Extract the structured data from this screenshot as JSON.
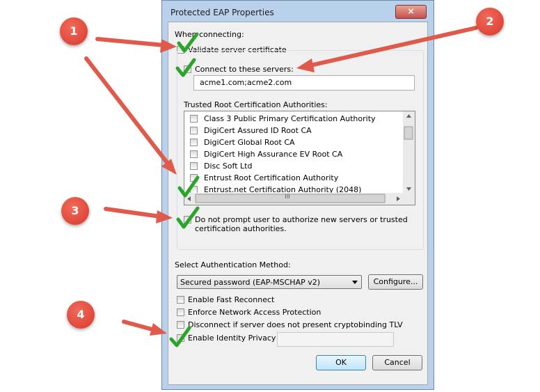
{
  "window": {
    "title": "Protected EAP Properties",
    "close_glyph": "×"
  },
  "connecting": {
    "header": "When connecting:",
    "validate_label": "Validate server certificate",
    "connect_label": "Connect to these servers:",
    "servers_value": "acme1.com;acme2.com"
  },
  "trusted": {
    "header": "Trusted Root Certification Authorities:",
    "items": [
      "Class 3 Public Primary Certification Authority",
      "DigiCert Assured ID Root CA",
      "DigiCert Global Root CA",
      "DigiCert High Assurance EV Root CA",
      "Disc Soft Ltd",
      "Entrust Root Certification Authority",
      "Entrust.net Certification Authority (2048)"
    ],
    "scroll_thumb_glyph": "III"
  },
  "prompt": {
    "line1": "Do not prompt user to authorize new servers or trusted",
    "line2": "certification authorities."
  },
  "auth": {
    "header": "Select Authentication Method:",
    "selected": "Secured password (EAP-MSCHAP v2)",
    "configure_label": "Configure..."
  },
  "options": {
    "fast_reconnect": "Enable Fast Reconnect",
    "nap": "Enforce Network Access Protection",
    "cryptobinding": "Disconnect if server does not present cryptobinding TLV",
    "identity_privacy": "Enable Identity Privacy"
  },
  "buttons": {
    "ok": "OK",
    "cancel": "Cancel"
  },
  "callouts": [
    "1",
    "2",
    "3",
    "4"
  ],
  "colors": {
    "arrow": "#e05a4c",
    "check": "#2aa52a",
    "callout": "#d8392b"
  }
}
